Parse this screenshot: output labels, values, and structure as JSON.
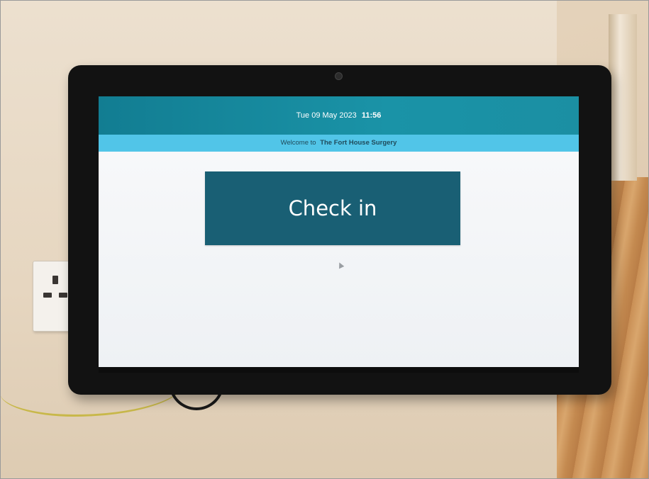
{
  "header": {
    "date": "Tue 09 May 2023",
    "time": "11:56"
  },
  "welcome": {
    "prefix": "Welcome to",
    "surgery_name": "The Fort House Surgery"
  },
  "main": {
    "check_in_label": "Check in"
  },
  "colors": {
    "header_teal": "#127d92",
    "welcome_light_blue": "#51c5e8",
    "button_dark_teal": "#195f74",
    "screen_background": "#f2f4f6"
  },
  "icons": {
    "cursor": "mouse-pointer-icon",
    "camera": "front-camera-icon"
  }
}
